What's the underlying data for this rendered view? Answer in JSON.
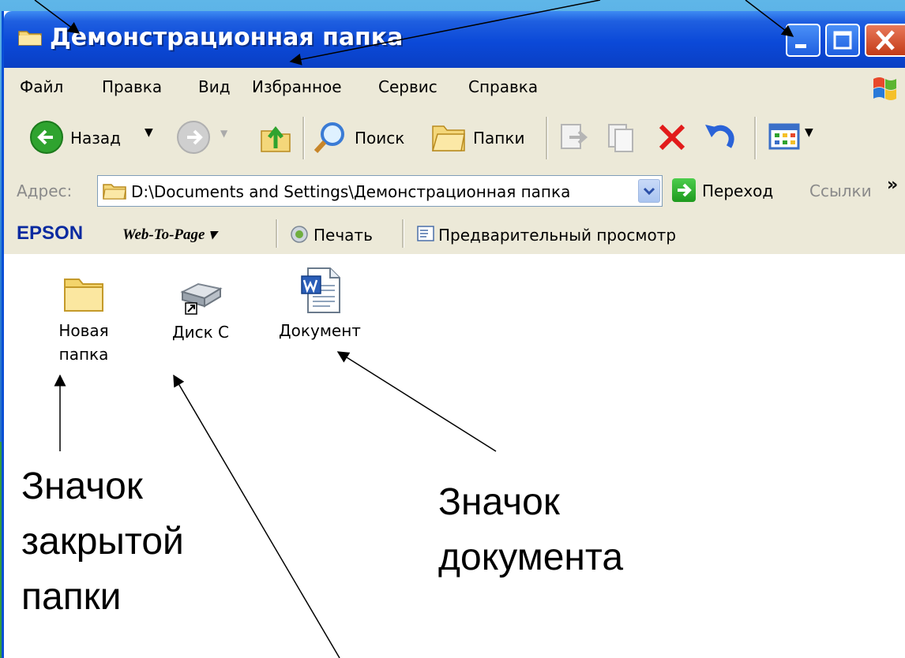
{
  "window": {
    "title": "Демонстрационная папка"
  },
  "menu": [
    "Файл",
    "Правка",
    "Вид",
    "Избранное",
    "Сервис",
    "Справка"
  ],
  "toolbar": {
    "back_label": "Назад",
    "search_label": "Поиск",
    "folders_label": "Папки"
  },
  "address": {
    "label": "Адрес:",
    "value": "D:\\Documents and Settings\\Демонстрационная папка",
    "go_label": "Переход",
    "links_label": "Ссылки",
    "chevron": "»"
  },
  "epson_bar": {
    "brand": "EPSON",
    "web_to_page": "Web-To-Page ▾",
    "print_label": "Печать",
    "preview_label": "Предварительный просмотр"
  },
  "items": [
    {
      "name": "Новая папка",
      "line1": "Новая",
      "line2": "папка",
      "icon": "folder-icon"
    },
    {
      "name": "Диск С",
      "line1": "Диск С",
      "icon": "drive-icon"
    },
    {
      "name": "Документ",
      "line1": "Документ",
      "icon": "word-document-icon"
    }
  ],
  "annotations": {
    "closed_folder": [
      "Значок",
      "закрытой",
      "папки"
    ],
    "document": [
      "Значок",
      "документа"
    ]
  },
  "colors": {
    "titlebar": "#0b49d8",
    "chrome": "#ece9d8",
    "delete_red": "#e21b1b",
    "go_green": "#1f9a1f"
  }
}
